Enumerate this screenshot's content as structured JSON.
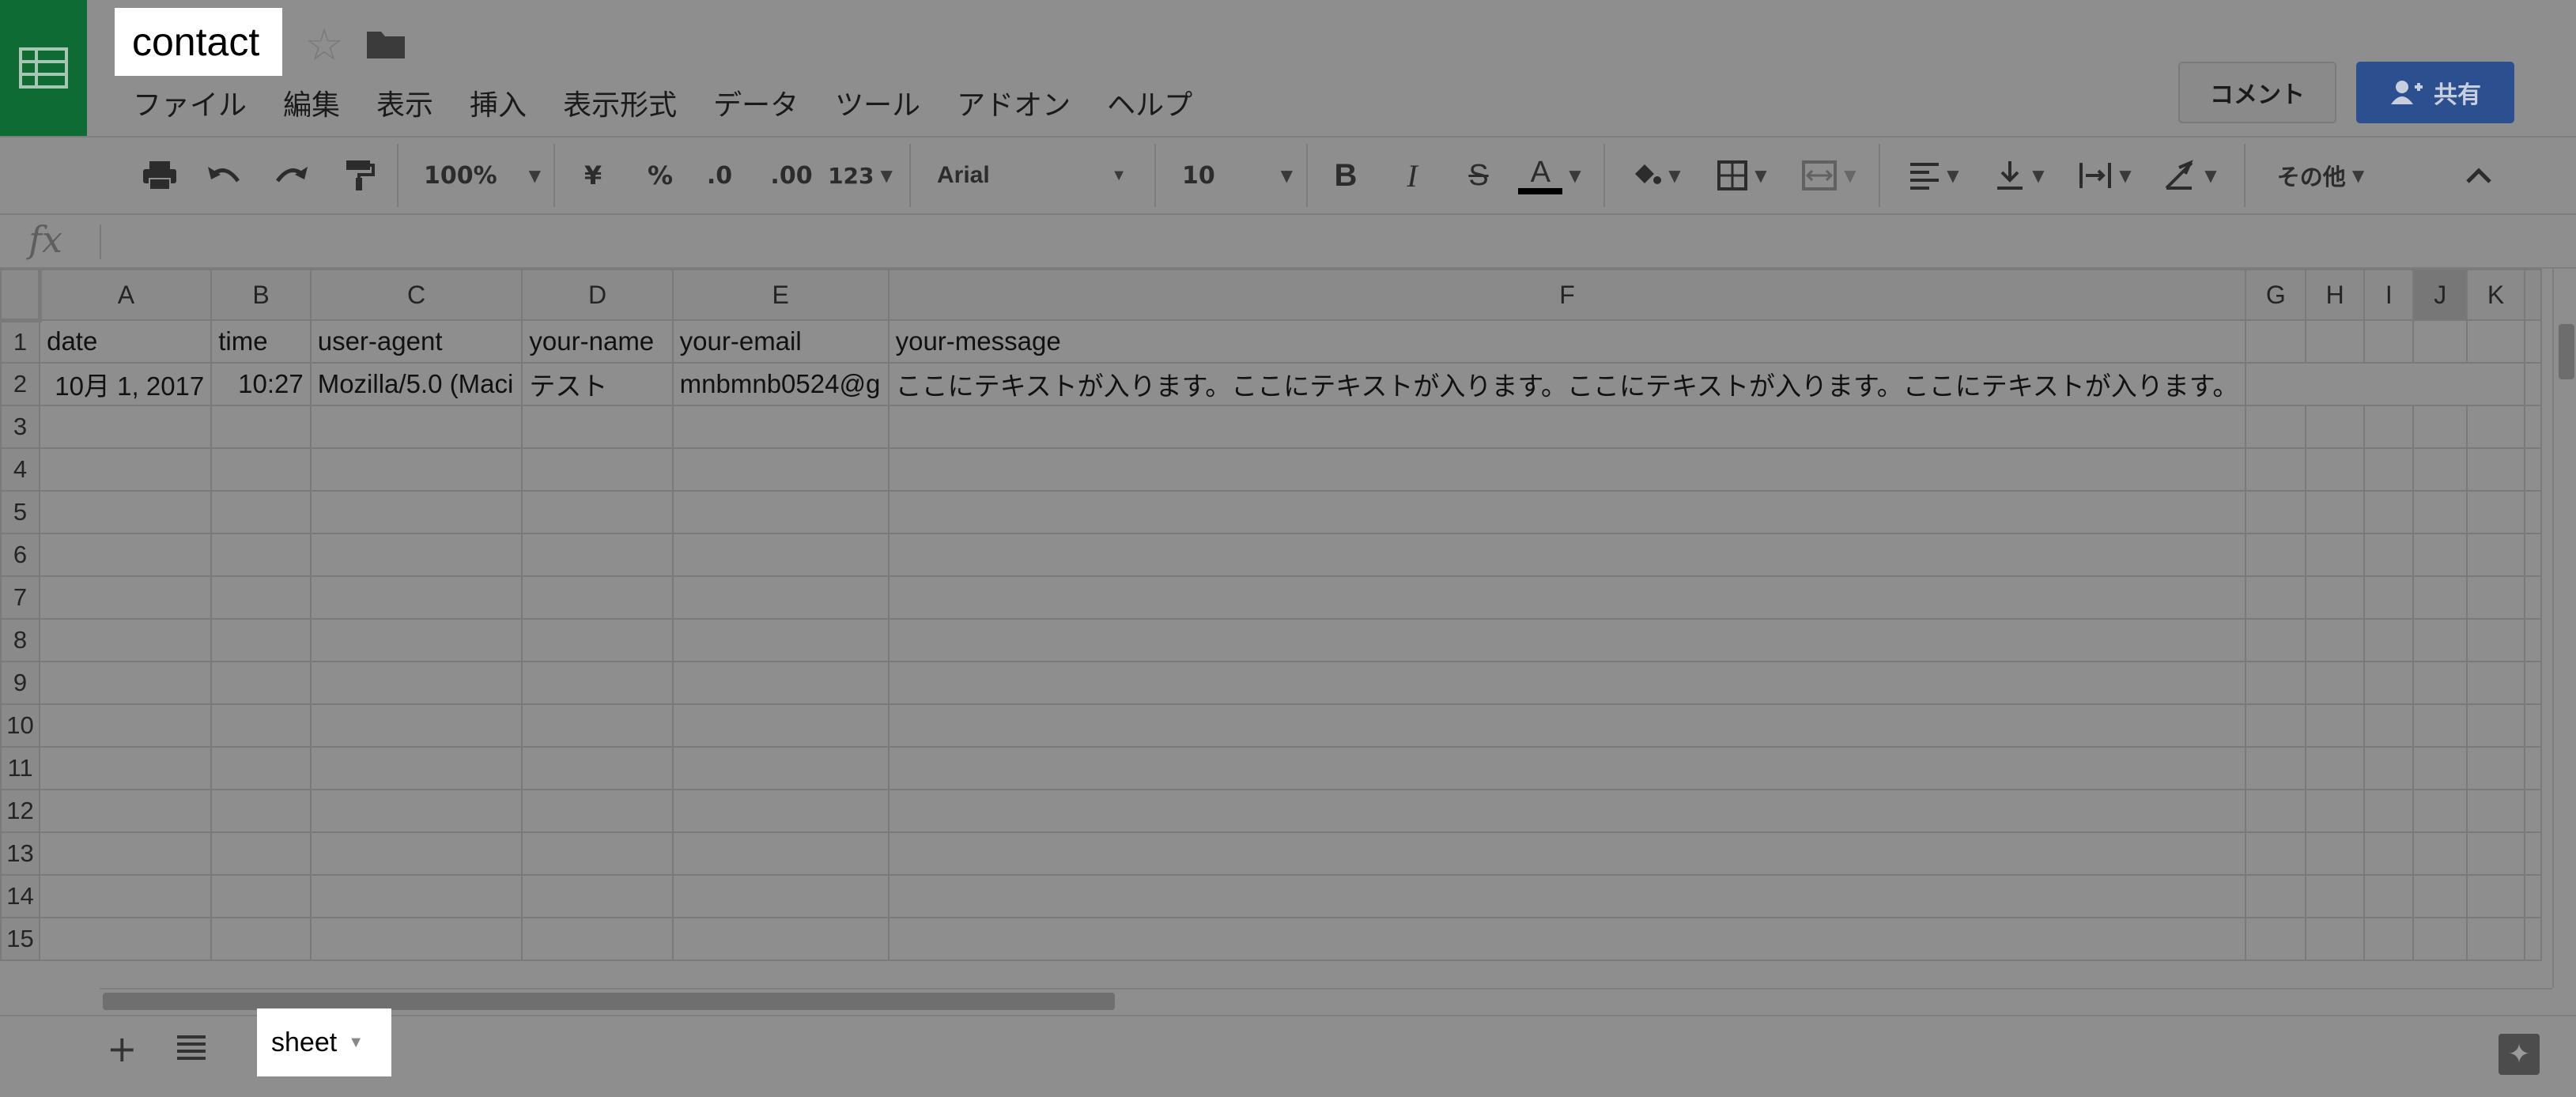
{
  "app": {
    "doc_title": "contact",
    "menu": [
      "ファイル",
      "編集",
      "表示",
      "挿入",
      "表示形式",
      "データ",
      "ツール",
      "アドオン",
      "ヘルプ"
    ],
    "comment_label": "コメント",
    "share_label": "共有"
  },
  "toolbar": {
    "zoom": "100%",
    "currency": "¥",
    "percent": "%",
    "dec_decrease": ".0",
    "dec_increase": ".00",
    "number_format": "123",
    "font": "Arial",
    "font_size": "10",
    "bold": "B",
    "italic": "I",
    "strike": "S",
    "text_color": "A",
    "more": "その他"
  },
  "formula_bar": {
    "fx": "fx",
    "value": ""
  },
  "grid": {
    "columns": [
      "A",
      "B",
      "C",
      "D",
      "E",
      "F",
      "G",
      "H",
      "I",
      "J",
      "K"
    ],
    "selected_column": "J",
    "row_numbers": [
      "1",
      "2",
      "3",
      "4",
      "5",
      "6",
      "7",
      "8",
      "9",
      "10",
      "11",
      "12",
      "13",
      "14",
      "15"
    ],
    "row1": [
      "date",
      "time",
      "user-agent",
      "your-name",
      "your-email",
      "your-message"
    ],
    "row2": [
      "10月 1, 2017",
      "10:27",
      "Mozilla/5.0 (Maci",
      "テスト",
      "mnbmnb0524@g",
      "ここにテキストが入ります。ここにテキストが入ります。ここにテキストが入ります。ここにテキストが入ります。"
    ]
  },
  "sheets": {
    "active": "sheet"
  },
  "colors": {
    "brand_green": "#0e6b34",
    "share_blue": "#2c4f8f"
  }
}
